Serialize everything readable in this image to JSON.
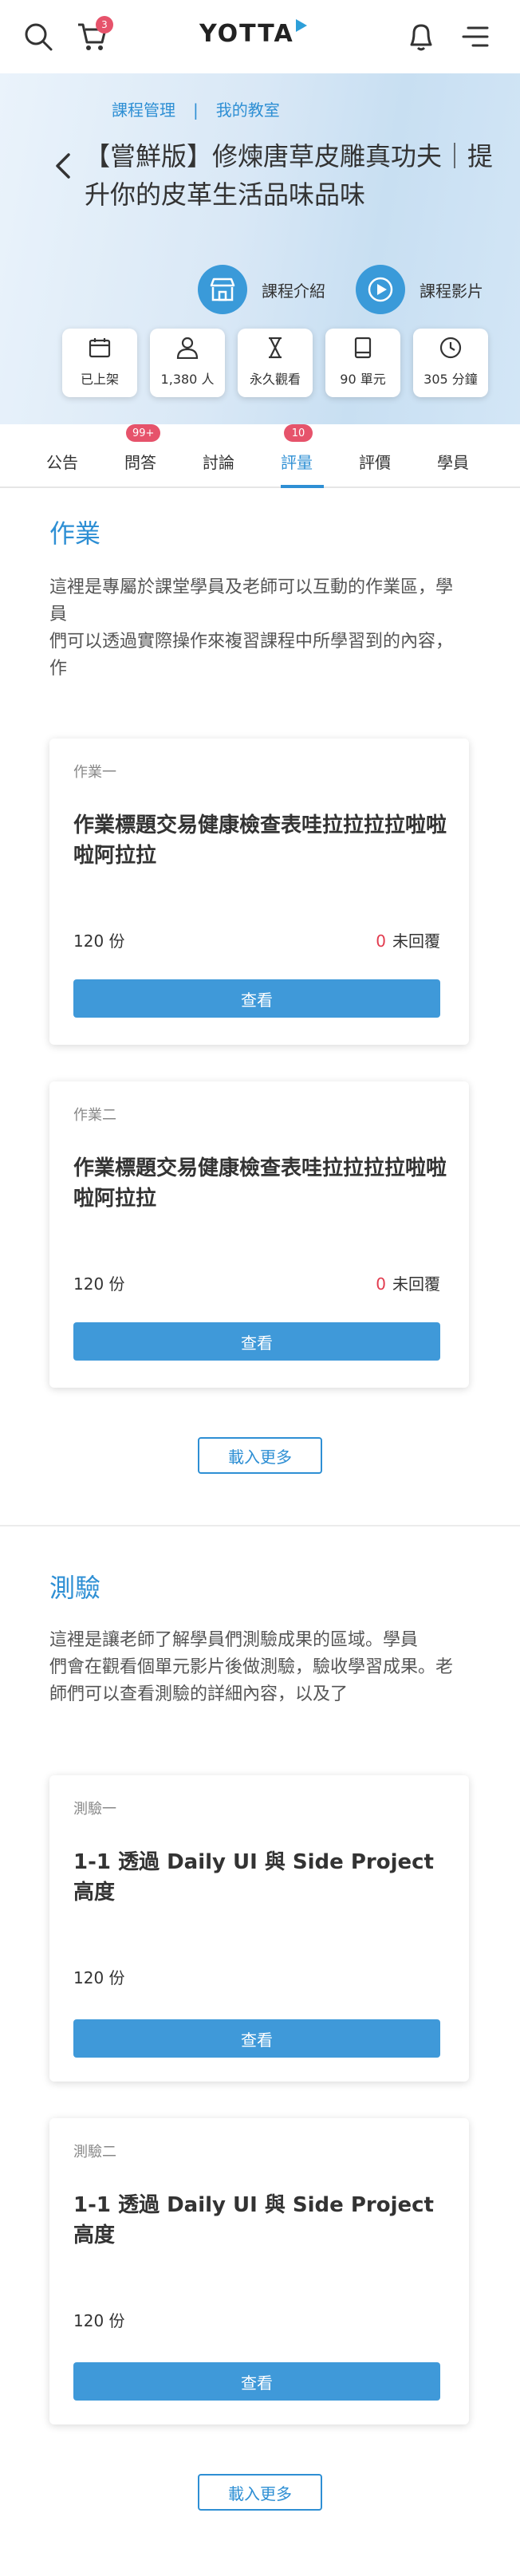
{
  "header": {
    "logo": "YOTTA",
    "cart_count": "3",
    "icons": [
      "search-icon",
      "cart-icon",
      "bell-icon",
      "menu-icon"
    ]
  },
  "breadcrumb": {
    "items": [
      "課程管理",
      "我的教室"
    ],
    "separator": "|"
  },
  "course": {
    "title": "【嘗鮮版】修煉唐草皮雕真功夫｜提升你的皮革生活品味品味",
    "buttons": [
      {
        "label": "課程介紹",
        "icon": "storefront-icon"
      },
      {
        "label": "課程影片",
        "icon": "play-icon"
      }
    ],
    "stats": [
      {
        "label": "已上架",
        "icon": "calendar-icon"
      },
      {
        "label": "1,380 人",
        "icon": "person-icon"
      },
      {
        "label": "永久觀看",
        "icon": "hourglass-icon"
      },
      {
        "label": "90 單元",
        "icon": "book-icon"
      },
      {
        "label": "305 分鐘",
        "icon": "clock-icon"
      }
    ]
  },
  "tabs": [
    {
      "label": "公告",
      "badge": ""
    },
    {
      "label": "問答",
      "badge": "99+"
    },
    {
      "label": "討論",
      "badge": ""
    },
    {
      "label": "評量",
      "badge": "10",
      "active": true
    },
    {
      "label": "評價",
      "badge": ""
    },
    {
      "label": "學員",
      "badge": ""
    }
  ],
  "assignments": {
    "title": "作業",
    "description_lines": [
      "這裡是專屬於課堂學員及老師可以互動的作業區，學員",
      "們可以透過實際操作來複習課程中所學習到的內容，作"
    ],
    "items": [
      {
        "kicker": "作業一",
        "title": "作業標題交易健康檢查表哇拉拉拉拉啦啦啦阿拉拉",
        "count": "120 份",
        "unreplied_num": "0",
        "unreplied_label": "未回覆",
        "button": "查看"
      },
      {
        "kicker": "作業二",
        "title": "作業標題交易健康檢查表哇拉拉拉拉啦啦啦阿拉拉",
        "count": "120 份",
        "unreplied_num": "0",
        "unreplied_label": "未回覆",
        "button": "查看"
      }
    ],
    "load_more": "載入更多"
  },
  "quizzes": {
    "title": "測驗",
    "description_lines": [
      "這裡是讓老師了解學員們測驗成果的區域。學員",
      "們會在觀看個單元影片後做測驗，驗收學習成果。老師們可以查看測驗的詳細內容，以及了"
    ],
    "items": [
      {
        "kicker": "測驗一",
        "title": "1-1 透過 Daily UI 與 Side Project 高度",
        "count": "120 份",
        "button": "查看"
      },
      {
        "kicker": "測驗二",
        "title": "1-1 透過 Daily UI 與 Side Project 高度",
        "count": "120 份",
        "button": "查看"
      }
    ],
    "load_more": "載入更多"
  },
  "colors": {
    "accent": "#2e8fd4",
    "button": "#3f99d9",
    "badge": "#e6536b",
    "unreplied": "#e23b4e"
  }
}
